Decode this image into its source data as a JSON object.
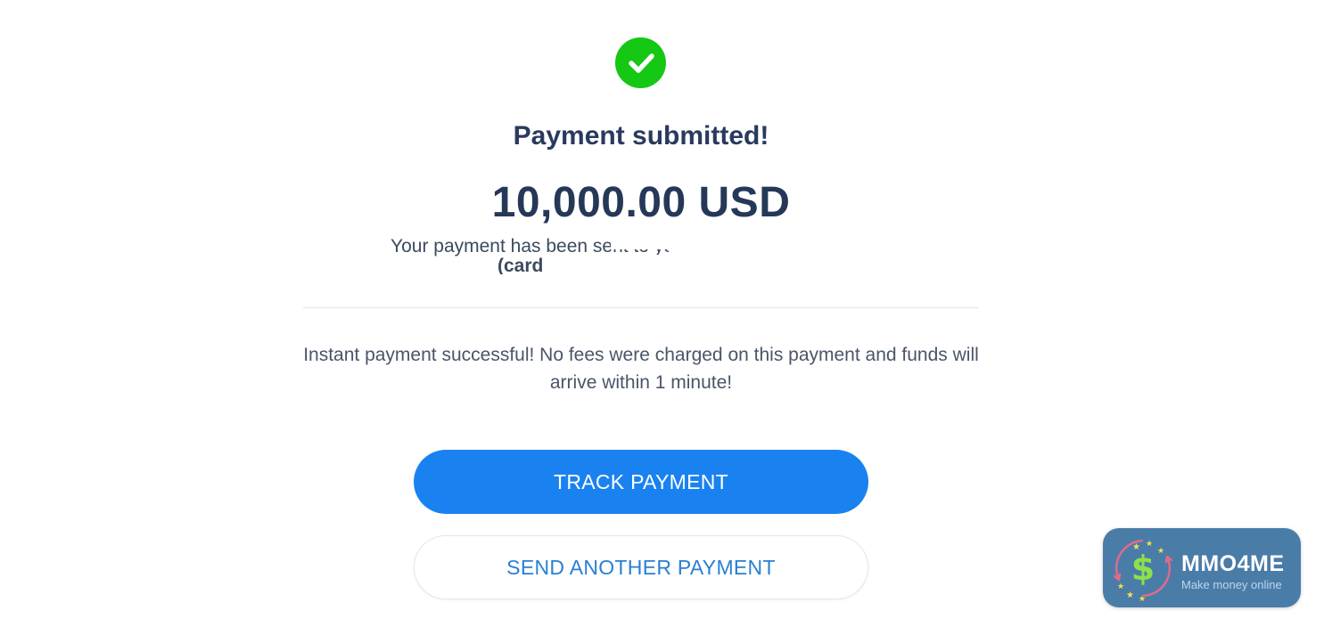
{
  "status": {
    "icon": "checkmark-circle-icon",
    "color": "#14c814",
    "title": "Payment submitted!"
  },
  "payment": {
    "amount": "10,000.00 USD",
    "sent_text": "Your payment has been sent to your",
    "sent_text_line2": "(card"
  },
  "message": {
    "text": "Instant payment successful! No fees were charged on this payment and funds will arrive within 1 minute!"
  },
  "actions": {
    "track_label": "TRACK PAYMENT",
    "send_another_label": "SEND ANOTHER PAYMENT",
    "primary_color": "#1a82f0",
    "secondary_text_color": "#2a7fd4"
  },
  "watermark": {
    "name": "MMO4ME",
    "tagline": "Make money online",
    "icon": "dollar-stars-logo-icon",
    "background": "#4a7ca8"
  }
}
